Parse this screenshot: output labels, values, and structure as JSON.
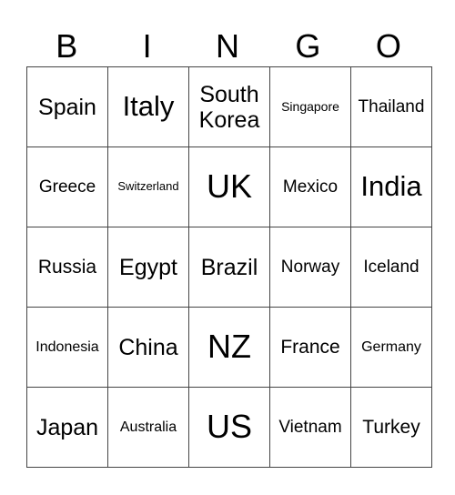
{
  "header": [
    "B",
    "I",
    "N",
    "G",
    "O"
  ],
  "rows": [
    [
      "Spain",
      "Italy",
      "South Korea",
      "Singapore",
      "Thailand"
    ],
    [
      "Greece",
      "Switzerland",
      "UK",
      "Mexico",
      "India"
    ],
    [
      "Russia",
      "Egypt",
      "Brazil",
      "Norway",
      "Iceland"
    ],
    [
      "Indonesia",
      "China",
      "NZ",
      "France",
      "Germany"
    ],
    [
      "Japan",
      "Australia",
      "US",
      "Vietnam",
      "Turkey"
    ]
  ]
}
